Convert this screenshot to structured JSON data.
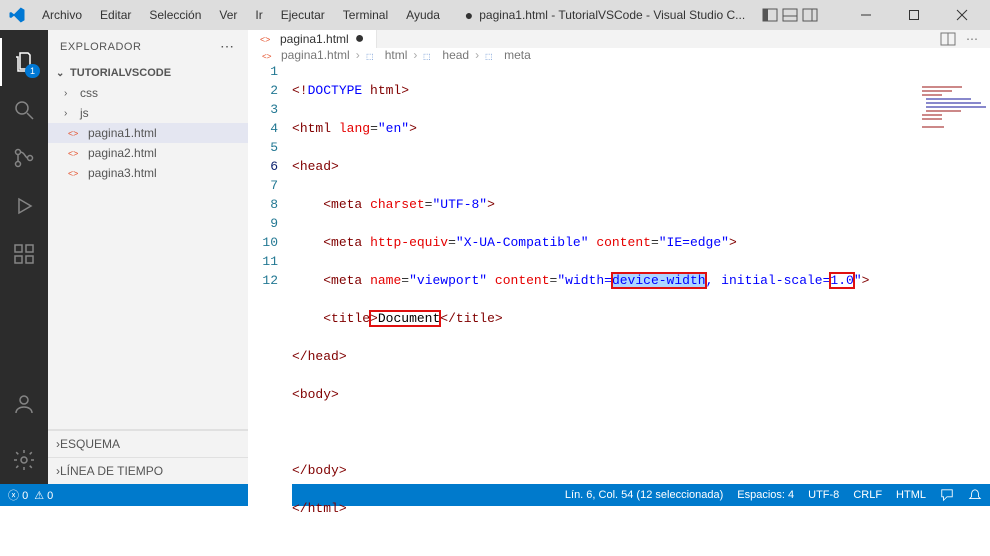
{
  "titlebar": {
    "menu": [
      "Archivo",
      "Editar",
      "Selección",
      "Ver",
      "Ir",
      "Ejecutar",
      "Terminal",
      "Ayuda"
    ],
    "title": "pagina1.html - TutorialVSCode - Visual Studio C..."
  },
  "activitybar": {
    "badge": "1"
  },
  "sidebar": {
    "header": "EXPLORADOR",
    "project": "TUTORIALVSCODE",
    "items": [
      {
        "type": "folder",
        "label": "css"
      },
      {
        "type": "folder",
        "label": "js"
      },
      {
        "type": "file",
        "label": "pagina1.html",
        "selected": true
      },
      {
        "type": "file",
        "label": "pagina2.html"
      },
      {
        "type": "file",
        "label": "pagina3.html"
      }
    ],
    "esquema": "ESQUEMA",
    "timeline": "LÍNEA DE TIEMPO"
  },
  "editor": {
    "tab": {
      "label": "pagina1.html"
    },
    "breadcrumb": [
      "pagina1.html",
      "html",
      "head",
      "meta"
    ],
    "lines": {
      "1": {
        "pre": "<!",
        "doctype": "DOCTYPE",
        "post": " ",
        "val": "html",
        "close": ">"
      },
      "2": {
        "open": "<",
        "tag": "html",
        "sp": " ",
        "attr": "lang",
        "eq": "=",
        "str": "\"en\"",
        "close": ">"
      },
      "3": {
        "open": "<",
        "tag": "head",
        "close": ">"
      },
      "4": {
        "indent": "    ",
        "open": "<",
        "tag": "meta",
        "sp": " ",
        "attr": "charset",
        "eq": "=",
        "str": "\"UTF-8\"",
        "close": ">"
      },
      "5": {
        "indent": "    ",
        "open": "<",
        "tag": "meta",
        "sp": " ",
        "attr1": "http-equiv",
        "eq": "=",
        "str1": "\"X-UA-Compatible\"",
        "sp2": " ",
        "attr2": "content",
        "str2": "\"IE=edge\"",
        "close": ">"
      },
      "6": {
        "indent": "    ",
        "open": "<",
        "tag": "meta",
        "sp": " ",
        "attr1": "name",
        "eq": "=",
        "str1": "\"viewport\"",
        "sp2": " ",
        "attr2": "content",
        "s2a": "\"width=",
        "s2sel": "device-width",
        "s2b": ", initial-scale=",
        "s2box": "1.0",
        "s2c": "\"",
        "close": ">"
      },
      "7": {
        "indent": "    ",
        "open": "<",
        "tag": "title",
        "close1": ">",
        "content": "Document",
        "open2": "</",
        "tag2": "title",
        "close2": ">"
      },
      "8": {
        "open": "</",
        "tag": "head",
        "close": ">"
      },
      "9": {
        "open": "<",
        "tag": "body",
        "close": ">"
      },
      "10": {
        "indent": "    "
      },
      "11": {
        "open": "</",
        "tag": "body",
        "close": ">"
      },
      "12": {
        "open": "</",
        "tag": "html",
        "close": ">"
      }
    }
  },
  "statusbar": {
    "errors": "0",
    "warnings": "0",
    "cursor": "Lín. 6, Col. 54 (12 seleccionada)",
    "spaces": "Espacios: 4",
    "encoding": "UTF-8",
    "eol": "CRLF",
    "lang": "HTML"
  }
}
